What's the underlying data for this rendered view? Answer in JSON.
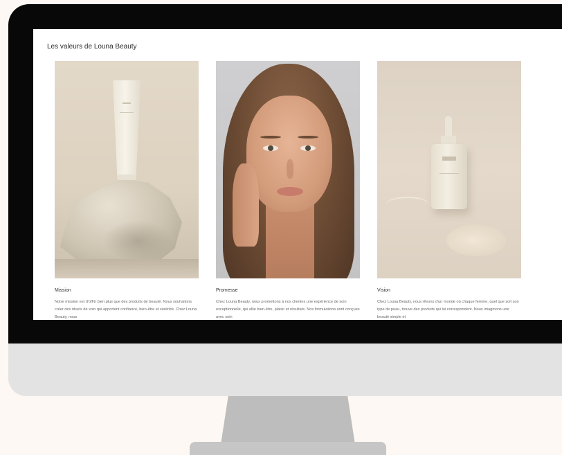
{
  "page": {
    "heading": "Les valeurs de Louna Beauty"
  },
  "cards": [
    {
      "title": "Mission",
      "text": "Notre mission est d'offrir bien plus que des produits de beauté. Nous souhaitons créer des rituels de soin qui apportent confiance, bien-être et sérénité. Chez Louna Beauty, nous"
    },
    {
      "title": "Promesse",
      "text": "Chez Louna Beauty, nous promettons à nos clientes une expérience de soin exceptionnelle, qui allie bien-être, plaisir et résultats. Nos formulations sont conçues avec soin"
    },
    {
      "title": "Vision",
      "text": "Chez Louna Beauty, nous rêvons d'un monde où chaque femme, quel que soit son type de peau, trouve des produits qui lui correspondent. Nous imaginons une beauté simple et"
    }
  ],
  "colors": {
    "page_background": "#fdf8f3",
    "monitor_bezel": "#080808",
    "monitor_chin": "#e3e3e3",
    "monitor_stand": "#bdbdbd"
  }
}
